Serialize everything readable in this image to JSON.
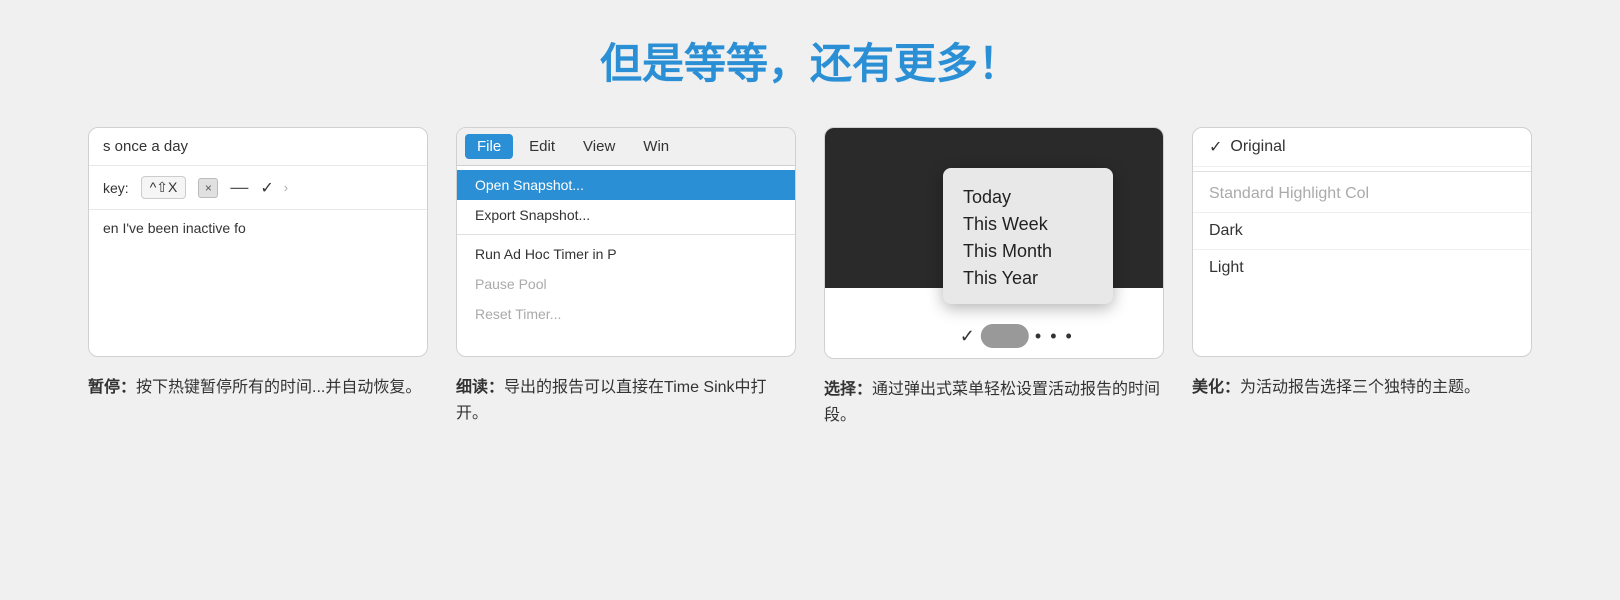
{
  "page": {
    "title": "但是等等，还有更多！",
    "background": "#f0f0f0"
  },
  "cards": [
    {
      "id": "pause-card",
      "rows": {
        "top": "s once a day",
        "key_label": "key:",
        "key_combo": "^⇧X",
        "key_x": "×",
        "key_check": "✓",
        "bottom": "en I've been inactive fo"
      },
      "caption_label": "暂停：",
      "caption_text": "按下热键暂停所有的时间...并自动恢复。"
    },
    {
      "id": "menu-card",
      "menu_items": [
        "File",
        "Edit",
        "View",
        "Win"
      ],
      "active_menu": "File",
      "options": [
        {
          "label": "Open Snapshot...",
          "highlighted": true,
          "disabled": false
        },
        {
          "label": "Export Snapshot...",
          "highlighted": false,
          "disabled": false
        },
        {
          "label": "",
          "divider": true
        },
        {
          "label": "Run Ad Hoc Timer in P",
          "highlighted": false,
          "disabled": false
        },
        {
          "label": "Pause Pool",
          "highlighted": false,
          "disabled": true
        },
        {
          "label": "Reset Timer...",
          "highlighted": false,
          "disabled": true
        }
      ],
      "caption_label": "细读：",
      "caption_text": "导出的报告可以直接在Time Sink中打开。"
    },
    {
      "id": "date-card",
      "date_options": [
        "Today",
        "This Week",
        "This Month",
        "This Year"
      ],
      "caption_label": "选择：",
      "caption_text": "通过弹出式菜单轻松设置活动报告的时间段。"
    },
    {
      "id": "theme-card",
      "themes": [
        {
          "label": "Original",
          "checked": true,
          "disabled": false
        },
        {
          "label": "Standard Highlight Col",
          "checked": false,
          "disabled": true
        },
        {
          "label": "Dark",
          "checked": false,
          "disabled": false
        },
        {
          "label": "Light",
          "checked": false,
          "disabled": false
        }
      ],
      "caption_label": "美化：",
      "caption_text": "为活动报告选择三个独特的主题。"
    }
  ]
}
